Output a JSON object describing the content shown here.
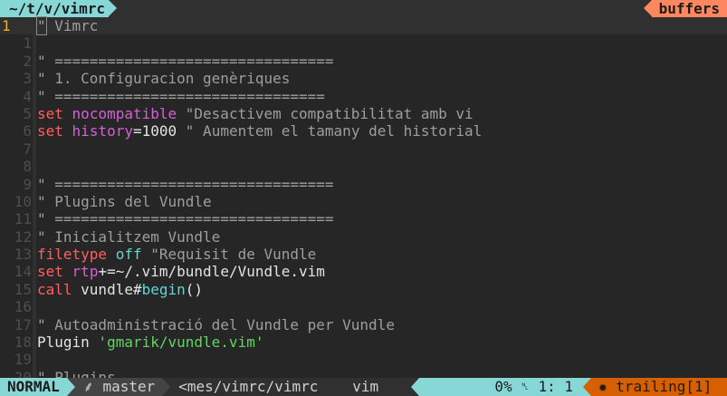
{
  "tabline": {
    "file_tab": "~/t/v/vimrc",
    "buffers_label": "buffers"
  },
  "lines": [
    {
      "num": "1",
      "parts": [
        {
          "t": "\"",
          "c": "c cursor"
        },
        {
          "t": " Vimrc",
          "c": "c"
        }
      ]
    },
    {
      "num": "1",
      "parts": []
    },
    {
      "num": "2",
      "parts": [
        {
          "t": "\" ================================",
          "c": "c"
        }
      ]
    },
    {
      "num": "3",
      "parts": [
        {
          "t": "\" 1. Configuracion genèriques",
          "c": "c"
        }
      ]
    },
    {
      "num": "4",
      "parts": [
        {
          "t": "\" ===============================",
          "c": "c"
        }
      ]
    },
    {
      "num": "5",
      "parts": [
        {
          "t": "set",
          "c": "k"
        },
        {
          "t": " "
        },
        {
          "t": "nocompatible",
          "c": "o"
        },
        {
          "t": " \"Desactivem compatibilitat amb vi",
          "c": "c"
        }
      ]
    },
    {
      "num": "6",
      "parts": [
        {
          "t": "set",
          "c": "k"
        },
        {
          "t": " "
        },
        {
          "t": "history",
          "c": "o"
        },
        {
          "t": "=1000",
          "c": "n"
        },
        {
          "t": " \" Aumentem el tamany del historial",
          "c": "c"
        }
      ]
    },
    {
      "num": "7",
      "parts": []
    },
    {
      "num": "8",
      "parts": []
    },
    {
      "num": "9",
      "parts": [
        {
          "t": "\" ================================",
          "c": "c"
        }
      ]
    },
    {
      "num": "10",
      "parts": [
        {
          "t": "\" Plugins del Vundle",
          "c": "c"
        }
      ]
    },
    {
      "num": "11",
      "parts": [
        {
          "t": "\" ================================",
          "c": "c"
        }
      ]
    },
    {
      "num": "12",
      "parts": [
        {
          "t": "\" Inicialitzem Vundle",
          "c": "c"
        }
      ]
    },
    {
      "num": "13",
      "parts": [
        {
          "t": "filetype",
          "c": "k"
        },
        {
          "t": " "
        },
        {
          "t": "off",
          "c": "cy"
        },
        {
          "t": " \"Requisit de Vundle",
          "c": "c"
        }
      ]
    },
    {
      "num": "14",
      "parts": [
        {
          "t": "set",
          "c": "k"
        },
        {
          "t": " "
        },
        {
          "t": "rtp",
          "c": "o"
        },
        {
          "t": "+=~/.vim/bundle/Vundle.vim",
          "c": "n"
        }
      ]
    },
    {
      "num": "15",
      "parts": [
        {
          "t": "call",
          "c": "k"
        },
        {
          "t": " vundle#",
          "c": "n"
        },
        {
          "t": "begin",
          "c": "cy"
        },
        {
          "t": "()",
          "c": "n"
        }
      ]
    },
    {
      "num": "16",
      "parts": []
    },
    {
      "num": "17",
      "parts": [
        {
          "t": "\" Autoadministració del Vundle per Vundle",
          "c": "c"
        }
      ]
    },
    {
      "num": "18",
      "parts": [
        {
          "t": "Plugin ",
          "c": "n"
        },
        {
          "t": "'gmarik/vundle.vim'",
          "c": "s"
        }
      ]
    },
    {
      "num": "19",
      "parts": []
    },
    {
      "num": "20",
      "parts": [
        {
          "t": "\" Plugins",
          "c": "c"
        }
      ]
    }
  ],
  "statusline": {
    "mode": "NORMAL",
    "branch_icon": "git-branch-icon",
    "branch": "master",
    "file": "<mes/vimrc/vimrc",
    "filetype": "vim",
    "percent": "0%",
    "line_icon": "line-number-icon",
    "line_glyph": "␤",
    "position": "1:  1",
    "warning_icon": "✹",
    "warning": "trailing[1]"
  },
  "colors": {
    "accent": "#87d7d7",
    "buffers": "#ff875f",
    "warning": "#d75f00"
  }
}
